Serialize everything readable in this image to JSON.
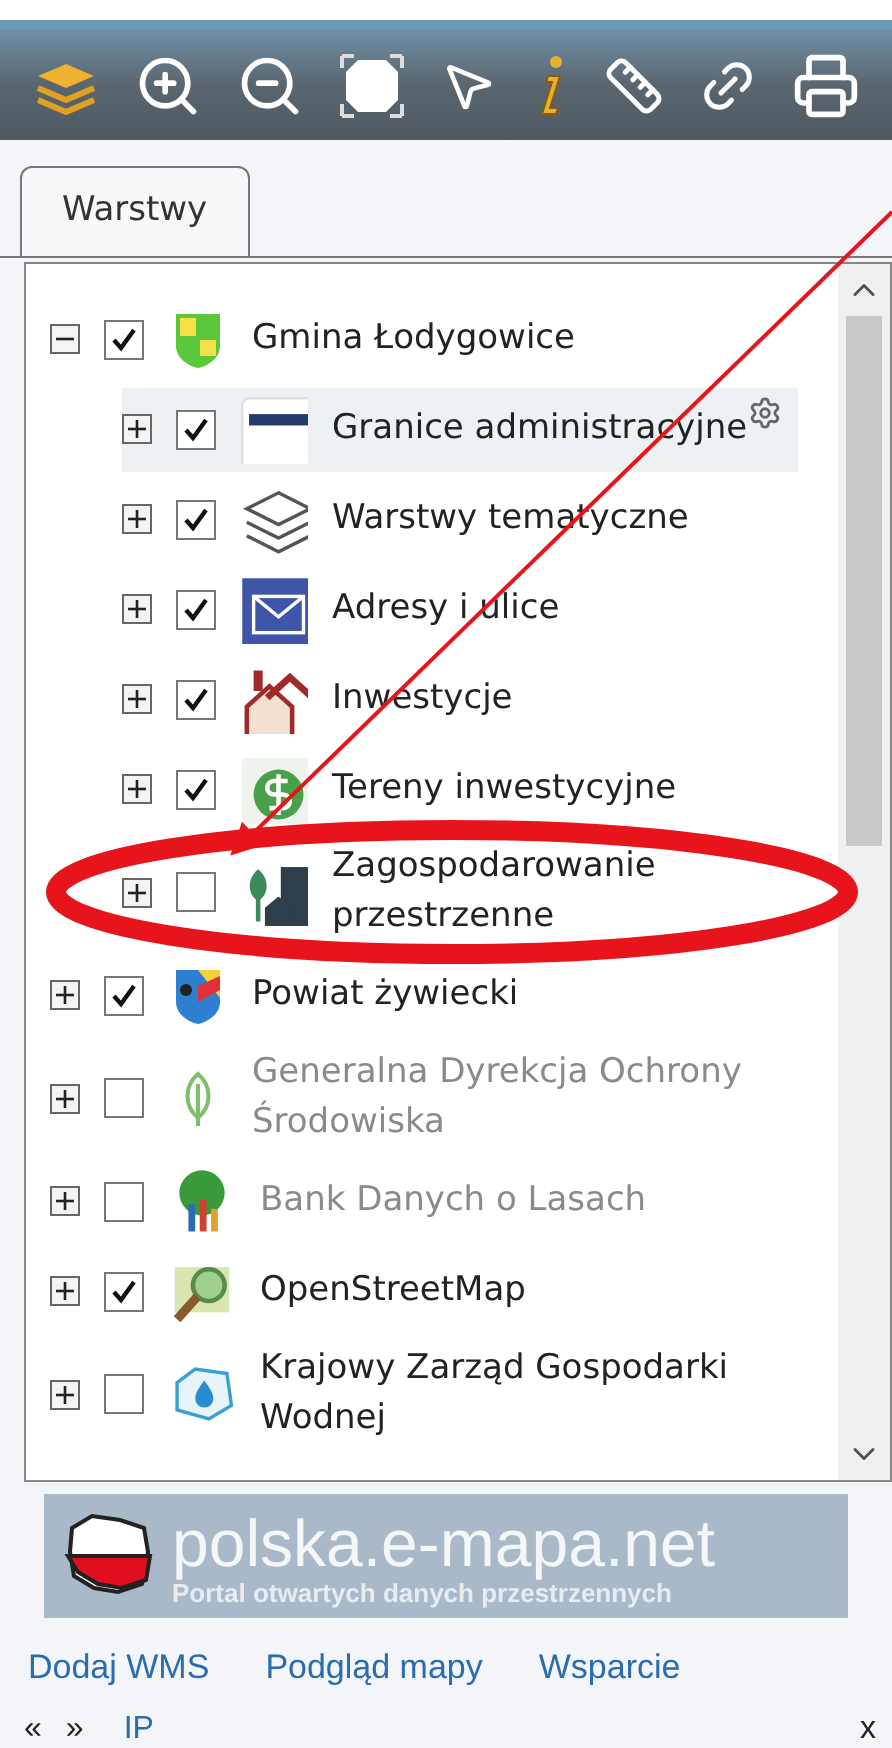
{
  "tabs": [
    {
      "label": "Warstwy",
      "selected": true
    }
  ],
  "layers": [
    {
      "label": "Gmina Łodygowice",
      "expanded": true,
      "checked": true,
      "disabled": false,
      "selected": false,
      "children": [
        {
          "label": "Granice administracyjne",
          "expanded": false,
          "checked": true,
          "disabled": false,
          "selected": true
        },
        {
          "label": "Warstwy tematyczne",
          "expanded": false,
          "checked": true,
          "disabled": false,
          "selected": false
        },
        {
          "label": "Adresy i ulice",
          "expanded": false,
          "checked": true,
          "disabled": false,
          "selected": false
        },
        {
          "label": "Inwestycje",
          "expanded": false,
          "checked": true,
          "disabled": false,
          "selected": false
        },
        {
          "label": "Tereny inwestycyjne",
          "expanded": false,
          "checked": true,
          "disabled": false,
          "selected": false
        },
        {
          "label": "Zagospodarowanie przestrzenne",
          "expanded": false,
          "checked": false,
          "disabled": false,
          "selected": false
        }
      ]
    },
    {
      "label": "Powiat żywiecki",
      "expanded": false,
      "checked": true,
      "disabled": false,
      "selected": false
    },
    {
      "label": "Generalna Dyrekcja Ochrony Środowiska",
      "expanded": false,
      "checked": false,
      "disabled": true,
      "selected": false
    },
    {
      "label": "Bank Danych o Lasach",
      "expanded": false,
      "checked": false,
      "disabled": true,
      "selected": false
    },
    {
      "label": "OpenStreetMap",
      "expanded": false,
      "checked": true,
      "disabled": false,
      "selected": false
    },
    {
      "label": "Krajowy Zarząd Gospodarki Wodnej",
      "expanded": false,
      "checked": false,
      "disabled": false,
      "selected": false
    }
  ],
  "banner": {
    "title": "polska.e-mapa.net",
    "subtitle": "Portal otwartych danych przestrzennych"
  },
  "links": [
    "Dodaj WMS",
    "Podgląd mapy",
    "Wsparcie"
  ],
  "footer": {
    "prev": "«",
    "next": "»",
    "link": "IP",
    "close": "x"
  }
}
